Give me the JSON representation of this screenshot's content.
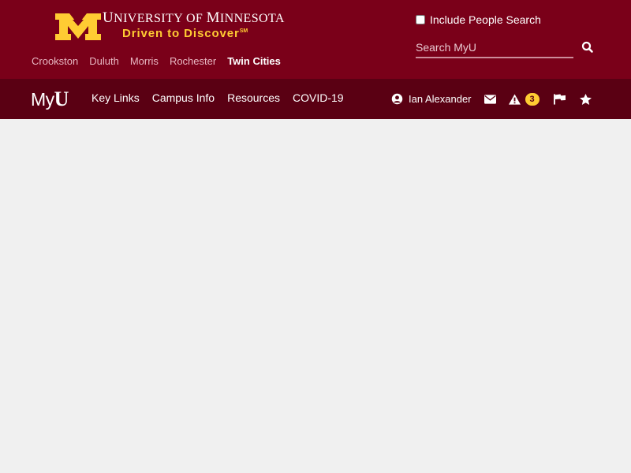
{
  "header": {
    "logo": {
      "university_name_first_letter": "U",
      "university_name_part1": "NIVERSITY OF ",
      "university_name_part2": "M",
      "university_name_part3": "INNESOTA",
      "tagline": "Driven to Discover",
      "tagline_mark": "SM"
    },
    "campuses": [
      "Crookston",
      "Duluth",
      "Morris",
      "Rochester",
      "Twin Cities"
    ],
    "active_campus": "Twin Cities",
    "people_search_label": "Include People Search",
    "search_placeholder": "Search MyU"
  },
  "navbar": {
    "logo_text_my": "My",
    "logo_text_u": "U",
    "links": [
      "Key Links",
      "Campus Info",
      "Resources",
      "COVID-19"
    ],
    "user_name": "Ian Alexander",
    "alerts_count": "3",
    "icons": [
      "user-circle-icon",
      "envelope-icon",
      "warning-icon",
      "flag-icon",
      "star-icon"
    ]
  },
  "colors": {
    "header_bg": "#7a0019",
    "navbar_bg": "#5a0013",
    "gold": "#ffcc33",
    "page_bg": "#f0f0f0"
  }
}
